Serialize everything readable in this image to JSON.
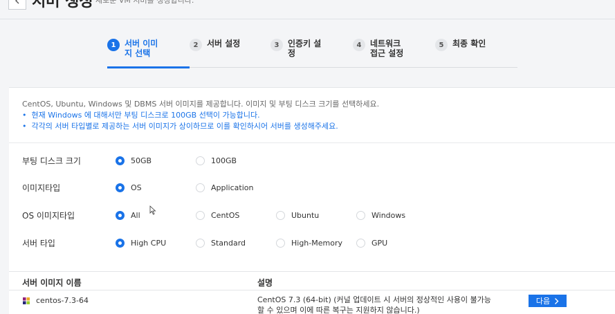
{
  "header": {
    "title": "서버 생성",
    "subtitle": "새로운 VM 서버를 생성합니다."
  },
  "steps": [
    {
      "num": "1",
      "label": "서버 이미지 선택"
    },
    {
      "num": "2",
      "label": "서버 설정"
    },
    {
      "num": "3",
      "label": "인증키 설정"
    },
    {
      "num": "4",
      "label": "네트워크 접근 설정"
    },
    {
      "num": "5",
      "label": "최종 확인"
    }
  ],
  "description": {
    "main": "CentOS, Ubuntu, Windows 및 DBMS 서버 이미지를 제공합니다. 이미지 및 부팅 디스크 크기를 선택하세요.",
    "bullets": [
      "현재 Windows 에 대해서만 부팅 디스크로 100GB 선택이 가능합니다.",
      "각각의 서버 타입별로 제공하는 서버 이미지가 상이하므로 이를 확인하시어 서버를 생성해주세요."
    ]
  },
  "filters": {
    "boot_disk": {
      "label": "부팅 디스크 크기",
      "options": [
        "50GB",
        "100GB"
      ],
      "selected": "50GB"
    },
    "image_type": {
      "label": "이미지타입",
      "options": [
        "OS",
        "Application"
      ],
      "selected": "OS"
    },
    "os_image_type": {
      "label": "OS 이미지타입",
      "options": [
        "All",
        "CentOS",
        "Ubuntu",
        "Windows"
      ],
      "selected": "All"
    },
    "server_type": {
      "label": "서버 타입",
      "options": [
        "High CPU",
        "Standard",
        "High-Memory",
        "GPU"
      ],
      "selected": "High CPU"
    }
  },
  "table": {
    "headers": {
      "name": "서버 이미지 이름",
      "desc": "설명"
    },
    "rows": [
      {
        "name": "centos-7.3-64",
        "desc": "CentOS 7.3 (64-bit) (커널 업데이트 시 서버의 정상적인 사용이 불가능할 수 있으며 이에 따른 복구는 지원하지 않습니다.)",
        "action": "다음"
      }
    ]
  },
  "colors": {
    "accent": "#1a73e8",
    "background": "#f4f5f7"
  }
}
